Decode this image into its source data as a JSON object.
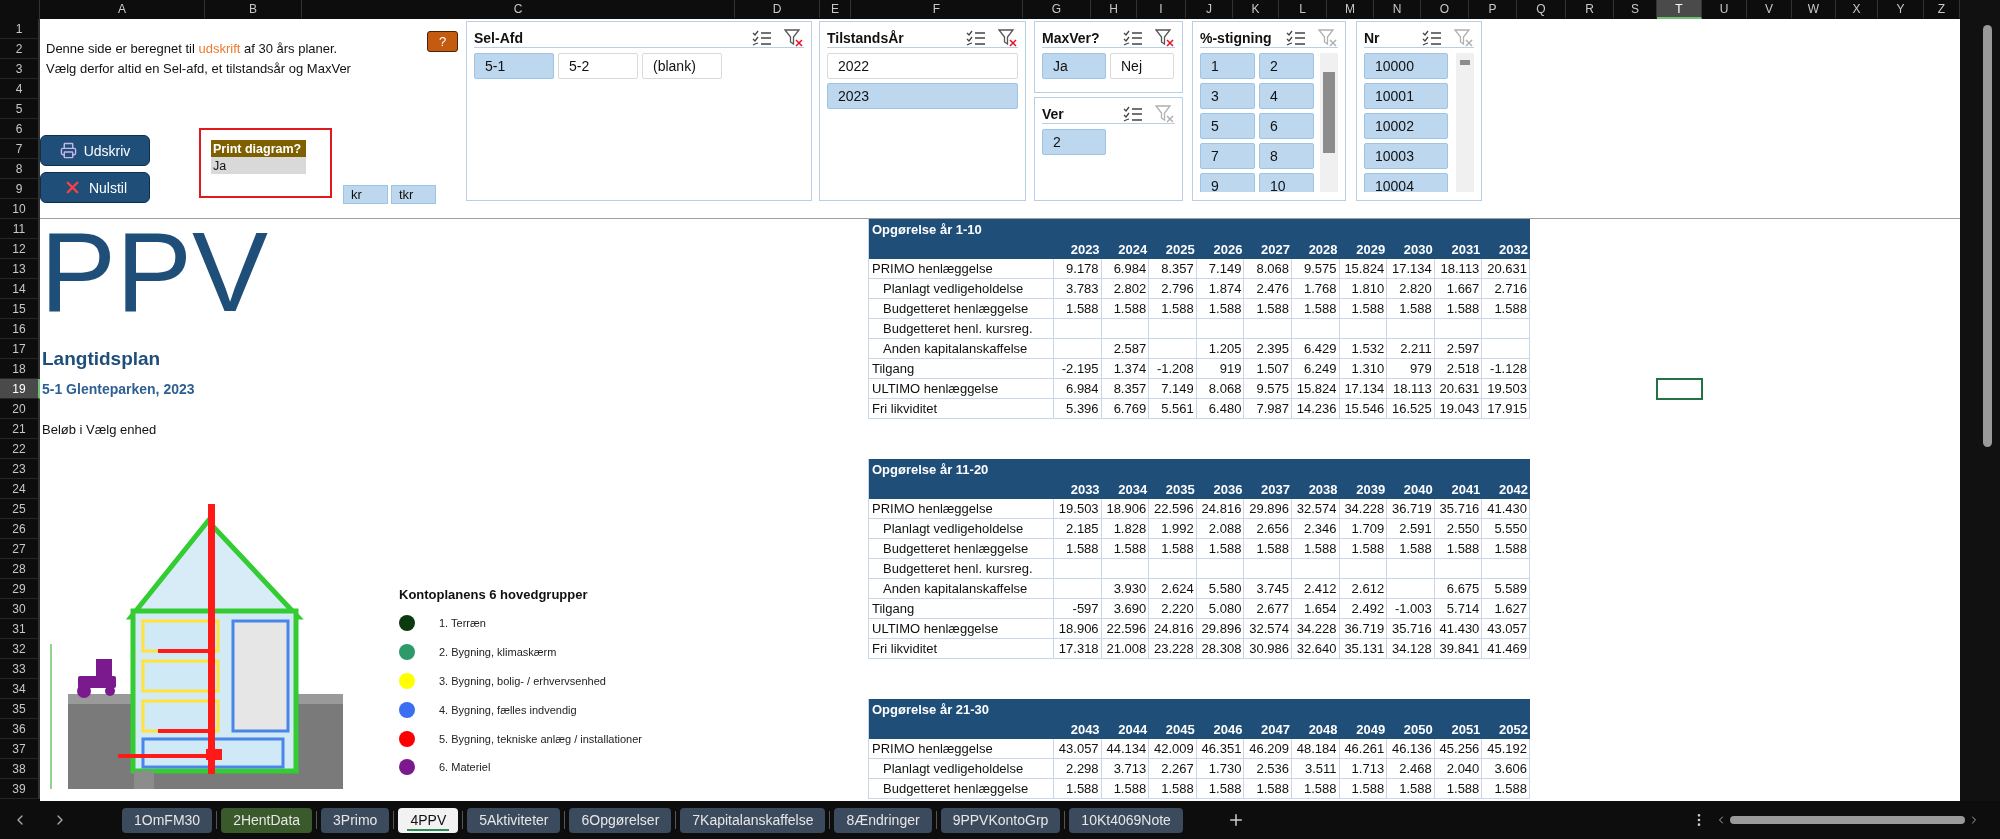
{
  "column_headers": [
    {
      "label": "A",
      "selected": false
    },
    {
      "label": "B",
      "selected": false
    },
    {
      "label": "C",
      "selected": false
    },
    {
      "label": "D",
      "selected": false
    },
    {
      "label": "E",
      "selected": false
    },
    {
      "label": "F",
      "selected": false
    },
    {
      "label": "G",
      "selected": false
    },
    {
      "label": "H",
      "selected": false
    },
    {
      "label": "I",
      "selected": false
    },
    {
      "label": "J",
      "selected": false
    },
    {
      "label": "K",
      "selected": false
    },
    {
      "label": "L",
      "selected": false
    },
    {
      "label": "M",
      "selected": false
    },
    {
      "label": "N",
      "selected": false
    },
    {
      "label": "O",
      "selected": false
    },
    {
      "label": "P",
      "selected": false
    },
    {
      "label": "Q",
      "selected": false
    },
    {
      "label": "R",
      "selected": false
    },
    {
      "label": "S",
      "selected": false
    },
    {
      "label": "T",
      "selected": true
    },
    {
      "label": "U",
      "selected": false
    },
    {
      "label": "V",
      "selected": false
    },
    {
      "label": "W",
      "selected": false
    },
    {
      "label": "X",
      "selected": false
    },
    {
      "label": "Y",
      "selected": false
    },
    {
      "label": "Z",
      "selected": false
    }
  ],
  "row_headers": [
    {
      "label": "1",
      "selected": false
    },
    {
      "label": "2",
      "selected": false
    },
    {
      "label": "3",
      "selected": false
    },
    {
      "label": "4",
      "selected": false
    },
    {
      "label": "5",
      "selected": false
    },
    {
      "label": "6",
      "selected": false
    },
    {
      "label": "7",
      "selected": false
    },
    {
      "label": "8",
      "selected": false
    },
    {
      "label": "9",
      "selected": false
    },
    {
      "label": "10",
      "selected": false
    },
    {
      "label": "11",
      "selected": false
    },
    {
      "label": "12",
      "selected": false
    },
    {
      "label": "13",
      "selected": false
    },
    {
      "label": "14",
      "selected": false
    },
    {
      "label": "15",
      "selected": false
    },
    {
      "label": "16",
      "selected": false
    },
    {
      "label": "17",
      "selected": false
    },
    {
      "label": "18",
      "selected": false
    },
    {
      "label": "19",
      "selected": true
    },
    {
      "label": "20",
      "selected": false
    },
    {
      "label": "21",
      "selected": false
    },
    {
      "label": "22",
      "selected": false
    },
    {
      "label": "23",
      "selected": false
    },
    {
      "label": "24",
      "selected": false
    },
    {
      "label": "25",
      "selected": false
    },
    {
      "label": "26",
      "selected": false
    },
    {
      "label": "27",
      "selected": false
    },
    {
      "label": "28",
      "selected": false
    },
    {
      "label": "29",
      "selected": false
    },
    {
      "label": "30",
      "selected": false
    },
    {
      "label": "31",
      "selected": false
    },
    {
      "label": "32",
      "selected": false
    },
    {
      "label": "33",
      "selected": false
    },
    {
      "label": "34",
      "selected": false
    },
    {
      "label": "35",
      "selected": false
    },
    {
      "label": "36",
      "selected": false
    },
    {
      "label": "37",
      "selected": false
    },
    {
      "label": "38",
      "selected": false
    },
    {
      "label": "39",
      "selected": false
    }
  ],
  "intro_lines": [
    [
      {
        "text": "Denne side er beregnet til ",
        "kind": "plain"
      },
      {
        "text": "udskrift",
        "kind": "highlight"
      },
      {
        "text": " af 30 års planer.",
        "kind": "plain"
      }
    ],
    [
      {
        "text": "Vælg derfor altid en Sel-afd, et tilstandsår og MaxVer",
        "kind": "plain"
      }
    ]
  ],
  "help_button": "?",
  "buttons": [
    {
      "label": "Udskriv",
      "kind": "print"
    },
    {
      "label": "Nulstil",
      "kind": "reset"
    }
  ],
  "print_diagram": {
    "label": "Print diagram?",
    "value": "Ja"
  },
  "unit_buttons": [
    "kr",
    "tkr"
  ],
  "slicers": [
    {
      "title": "Sel-Afd",
      "kind": "three-column",
      "filtered": true,
      "items": [
        {
          "label": "5-1",
          "selected": true
        },
        {
          "label": "5-2",
          "selected": false
        },
        {
          "label": "(blank)",
          "selected": false
        }
      ]
    },
    {
      "title": "TilstandsÅr",
      "kind": "one-column",
      "filtered": true,
      "items": [
        {
          "label": "2022",
          "selected": false
        },
        {
          "label": "2023",
          "selected": true
        }
      ]
    },
    {
      "title": "MaxVer?",
      "kind": "two-column",
      "filtered": true,
      "items": [
        {
          "label": "Ja",
          "selected": true
        },
        {
          "label": "Nej",
          "selected": false
        }
      ]
    },
    {
      "title": "Ver",
      "kind": "two-column",
      "filtered": false,
      "items": [
        {
          "label": "2",
          "selected": true
        }
      ]
    },
    {
      "title": "%-stigning",
      "kind": "two-column-scroll",
      "filtered": false,
      "items": [
        {
          "label": "1",
          "selected": true
        },
        {
          "label": "2",
          "selected": true
        },
        {
          "label": "3",
          "selected": true
        },
        {
          "label": "4",
          "selected": true
        },
        {
          "label": "5",
          "selected": true
        },
        {
          "label": "6",
          "selected": true
        },
        {
          "label": "7",
          "selected": true
        },
        {
          "label": "8",
          "selected": true
        },
        {
          "label": "9",
          "selected": true
        },
        {
          "label": "10",
          "selected": true
        }
      ]
    },
    {
      "title": "Nr",
      "kind": "one-column-scroll",
      "filtered": false,
      "items": [
        {
          "label": "10000",
          "selected": true
        },
        {
          "label": "10001",
          "selected": true
        },
        {
          "label": "10002",
          "selected": true
        },
        {
          "label": "10003",
          "selected": true
        },
        {
          "label": "10004",
          "selected": true
        }
      ]
    }
  ],
  "title": "PPV",
  "subtitle": "Langtidsplan",
  "plan_name": "5-1 Glenteparken, 2023",
  "amount_note": "Beløb i Vælg enhed",
  "legend": {
    "title": "Kontoplanens 6 hovedgrupper",
    "items": [
      {
        "label": "1. Terræn",
        "color": "#0b3a10"
      },
      {
        "label": "2. Bygning, klimaskærm",
        "color": "#2e9a6a"
      },
      {
        "label": "3. Bygning, bolig- / erhvervsenhed",
        "color": "#ffff00"
      },
      {
        "label": "4. Bygning, fælles indvendig",
        "color": "#3b6ff2"
      },
      {
        "label": "5. Bygning, tekniske anlæg / installationer",
        "color": "#ff0000"
      },
      {
        "label": "6. Materiel",
        "color": "#7b1a8e"
      }
    ]
  },
  "tables": [
    {
      "title": "Opgørelse år 1-10",
      "years": [
        "2023",
        "2024",
        "2025",
        "2026",
        "2027",
        "2028",
        "2029",
        "2030",
        "2031",
        "2032"
      ],
      "rows": [
        {
          "label": "PRIMO henlæggelse",
          "indent": false,
          "cells": [
            {
              "kind": "number",
              "value": "9.178"
            },
            {
              "kind": "number",
              "value": "6.984"
            },
            {
              "kind": "number",
              "value": "8.357"
            },
            {
              "kind": "number",
              "value": "7.149"
            },
            {
              "kind": "number",
              "value": "8.068"
            },
            {
              "kind": "number",
              "value": "9.575"
            },
            {
              "kind": "number",
              "value": "15.824"
            },
            {
              "kind": "number",
              "value": "17.134"
            },
            {
              "kind": "number",
              "value": "18.113"
            },
            {
              "kind": "number",
              "value": "20.631"
            }
          ]
        },
        {
          "label": "Planlagt vedligeholdelse",
          "indent": true,
          "cells": [
            {
              "kind": "number",
              "value": "3.783"
            },
            {
              "kind": "number",
              "value": "2.802"
            },
            {
              "kind": "number",
              "value": "2.796"
            },
            {
              "kind": "number",
              "value": "1.874"
            },
            {
              "kind": "number",
              "value": "2.476"
            },
            {
              "kind": "number",
              "value": "1.768"
            },
            {
              "kind": "number",
              "value": "1.810"
            },
            {
              "kind": "number",
              "value": "2.820"
            },
            {
              "kind": "number",
              "value": "1.667"
            },
            {
              "kind": "number",
              "value": "2.716"
            }
          ]
        },
        {
          "label": "Budgetteret henlæggelse",
          "indent": true,
          "cells": [
            {
              "kind": "number",
              "value": "1.588"
            },
            {
              "kind": "number",
              "value": "1.588"
            },
            {
              "kind": "number",
              "value": "1.588"
            },
            {
              "kind": "number",
              "value": "1.588"
            },
            {
              "kind": "number",
              "value": "1.588"
            },
            {
              "kind": "number",
              "value": "1.588"
            },
            {
              "kind": "number",
              "value": "1.588"
            },
            {
              "kind": "number",
              "value": "1.588"
            },
            {
              "kind": "number",
              "value": "1.588"
            },
            {
              "kind": "number",
              "value": "1.588"
            }
          ]
        },
        {
          "label": "Budgetteret henl. kursreg.",
          "indent": true,
          "cells": [
            {
              "kind": "blank"
            },
            {
              "kind": "blank"
            },
            {
              "kind": "blank"
            },
            {
              "kind": "blank"
            },
            {
              "kind": "blank"
            },
            {
              "kind": "blank"
            },
            {
              "kind": "blank"
            },
            {
              "kind": "blank"
            },
            {
              "kind": "blank"
            },
            {
              "kind": "blank"
            }
          ]
        },
        {
          "label": "Anden kapitalanskaffelse",
          "indent": true,
          "cells": [
            {
              "kind": "blank"
            },
            {
              "kind": "number",
              "value": "2.587"
            },
            {
              "kind": "blank"
            },
            {
              "kind": "number",
              "value": "1.205"
            },
            {
              "kind": "number",
              "value": "2.395"
            },
            {
              "kind": "number",
              "value": "6.429"
            },
            {
              "kind": "number",
              "value": "1.532"
            },
            {
              "kind": "number",
              "value": "2.211"
            },
            {
              "kind": "number",
              "value": "2.597"
            },
            {
              "kind": "blank"
            }
          ]
        },
        {
          "label": "Tilgang",
          "indent": false,
          "cells": [
            {
              "kind": "number",
              "value": "-2.195"
            },
            {
              "kind": "number",
              "value": "1.374"
            },
            {
              "kind": "number",
              "value": "-1.208"
            },
            {
              "kind": "number",
              "value": "919"
            },
            {
              "kind": "number",
              "value": "1.507"
            },
            {
              "kind": "number",
              "value": "6.249"
            },
            {
              "kind": "number",
              "value": "1.310"
            },
            {
              "kind": "number",
              "value": "979"
            },
            {
              "kind": "number",
              "value": "2.518"
            },
            {
              "kind": "number",
              "value": "-1.128"
            }
          ]
        },
        {
          "label": "ULTIMO henlæggelse",
          "indent": false,
          "cells": [
            {
              "kind": "number",
              "value": "6.984"
            },
            {
              "kind": "number",
              "value": "8.357"
            },
            {
              "kind": "number",
              "value": "7.149"
            },
            {
              "kind": "number",
              "value": "8.068"
            },
            {
              "kind": "number",
              "value": "9.575"
            },
            {
              "kind": "number",
              "value": "15.824"
            },
            {
              "kind": "number",
              "value": "17.134"
            },
            {
              "kind": "number",
              "value": "18.113"
            },
            {
              "kind": "number",
              "value": "20.631"
            },
            {
              "kind": "number",
              "value": "19.503"
            }
          ]
        },
        {
          "label": "Fri likviditet",
          "indent": false,
          "cells": [
            {
              "kind": "number",
              "value": "5.396"
            },
            {
              "kind": "number",
              "value": "6.769"
            },
            {
              "kind": "number",
              "value": "5.561"
            },
            {
              "kind": "number",
              "value": "6.480"
            },
            {
              "kind": "number",
              "value": "7.987"
            },
            {
              "kind": "number",
              "value": "14.236"
            },
            {
              "kind": "number",
              "value": "15.546"
            },
            {
              "kind": "number",
              "value": "16.525"
            },
            {
              "kind": "number",
              "value": "19.043"
            },
            {
              "kind": "number",
              "value": "17.915"
            }
          ]
        }
      ]
    },
    {
      "title": "Opgørelse år 11-20",
      "years": [
        "2033",
        "2034",
        "2035",
        "2036",
        "2037",
        "2038",
        "2039",
        "2040",
        "2041",
        "2042"
      ],
      "rows": [
        {
          "label": "PRIMO henlæggelse",
          "indent": false,
          "cells": [
            {
              "kind": "number",
              "value": "19.503"
            },
            {
              "kind": "number",
              "value": "18.906"
            },
            {
              "kind": "number",
              "value": "22.596"
            },
            {
              "kind": "number",
              "value": "24.816"
            },
            {
              "kind": "number",
              "value": "29.896"
            },
            {
              "kind": "number",
              "value": "32.574"
            },
            {
              "kind": "number",
              "value": "34.228"
            },
            {
              "kind": "number",
              "value": "36.719"
            },
            {
              "kind": "number",
              "value": "35.716"
            },
            {
              "kind": "number",
              "value": "41.430"
            }
          ]
        },
        {
          "label": "Planlagt vedligeholdelse",
          "indent": true,
          "cells": [
            {
              "kind": "number",
              "value": "2.185"
            },
            {
              "kind": "number",
              "value": "1.828"
            },
            {
              "kind": "number",
              "value": "1.992"
            },
            {
              "kind": "number",
              "value": "2.088"
            },
            {
              "kind": "number",
              "value": "2.656"
            },
            {
              "kind": "number",
              "value": "2.346"
            },
            {
              "kind": "number",
              "value": "1.709"
            },
            {
              "kind": "number",
              "value": "2.591"
            },
            {
              "kind": "number",
              "value": "2.550"
            },
            {
              "kind": "number",
              "value": "5.550"
            }
          ]
        },
        {
          "label": "Budgetteret henlæggelse",
          "indent": true,
          "cells": [
            {
              "kind": "number",
              "value": "1.588"
            },
            {
              "kind": "number",
              "value": "1.588"
            },
            {
              "kind": "number",
              "value": "1.588"
            },
            {
              "kind": "number",
              "value": "1.588"
            },
            {
              "kind": "number",
              "value": "1.588"
            },
            {
              "kind": "number",
              "value": "1.588"
            },
            {
              "kind": "number",
              "value": "1.588"
            },
            {
              "kind": "number",
              "value": "1.588"
            },
            {
              "kind": "number",
              "value": "1.588"
            },
            {
              "kind": "number",
              "value": "1.588"
            }
          ]
        },
        {
          "label": "Budgetteret henl. kursreg.",
          "indent": true,
          "cells": [
            {
              "kind": "blank"
            },
            {
              "kind": "blank"
            },
            {
              "kind": "blank"
            },
            {
              "kind": "blank"
            },
            {
              "kind": "blank"
            },
            {
              "kind": "blank"
            },
            {
              "kind": "blank"
            },
            {
              "kind": "blank"
            },
            {
              "kind": "blank"
            },
            {
              "kind": "blank"
            }
          ]
        },
        {
          "label": "Anden kapitalanskaffelse",
          "indent": true,
          "cells": [
            {
              "kind": "blank"
            },
            {
              "kind": "number",
              "value": "3.930"
            },
            {
              "kind": "number",
              "value": "2.624"
            },
            {
              "kind": "number",
              "value": "5.580"
            },
            {
              "kind": "number",
              "value": "3.745"
            },
            {
              "kind": "number",
              "value": "2.412"
            },
            {
              "kind": "number",
              "value": "2.612"
            },
            {
              "kind": "blank"
            },
            {
              "kind": "number",
              "value": "6.675"
            },
            {
              "kind": "number",
              "value": "5.589"
            }
          ]
        },
        {
          "label": "Tilgang",
          "indent": false,
          "cells": [
            {
              "kind": "number",
              "value": "-597"
            },
            {
              "kind": "number",
              "value": "3.690"
            },
            {
              "kind": "number",
              "value": "2.220"
            },
            {
              "kind": "number",
              "value": "5.080"
            },
            {
              "kind": "number",
              "value": "2.677"
            },
            {
              "kind": "number",
              "value": "1.654"
            },
            {
              "kind": "number",
              "value": "2.492"
            },
            {
              "kind": "number",
              "value": "-1.003"
            },
            {
              "kind": "number",
              "value": "5.714"
            },
            {
              "kind": "number",
              "value": "1.627"
            }
          ]
        },
        {
          "label": "ULTIMO henlæggelse",
          "indent": false,
          "cells": [
            {
              "kind": "number",
              "value": "18.906"
            },
            {
              "kind": "number",
              "value": "22.596"
            },
            {
              "kind": "number",
              "value": "24.816"
            },
            {
              "kind": "number",
              "value": "29.896"
            },
            {
              "kind": "number",
              "value": "32.574"
            },
            {
              "kind": "number",
              "value": "34.228"
            },
            {
              "kind": "number",
              "value": "36.719"
            },
            {
              "kind": "number",
              "value": "35.716"
            },
            {
              "kind": "number",
              "value": "41.430"
            },
            {
              "kind": "number",
              "value": "43.057"
            }
          ]
        },
        {
          "label": "Fri likviditet",
          "indent": false,
          "cells": [
            {
              "kind": "number",
              "value": "17.318"
            },
            {
              "kind": "number",
              "value": "21.008"
            },
            {
              "kind": "number",
              "value": "23.228"
            },
            {
              "kind": "number",
              "value": "28.308"
            },
            {
              "kind": "number",
              "value": "30.986"
            },
            {
              "kind": "number",
              "value": "32.640"
            },
            {
              "kind": "number",
              "value": "35.131"
            },
            {
              "kind": "number",
              "value": "34.128"
            },
            {
              "kind": "number",
              "value": "39.841"
            },
            {
              "kind": "number",
              "value": "41.469"
            }
          ]
        }
      ]
    },
    {
      "title": "Opgørelse år 21-30",
      "years": [
        "2043",
        "2044",
        "2045",
        "2046",
        "2047",
        "2048",
        "2049",
        "2050",
        "2051",
        "2052"
      ],
      "rows": [
        {
          "label": "PRIMO henlæggelse",
          "indent": false,
          "cells": [
            {
              "kind": "number",
              "value": "43.057"
            },
            {
              "kind": "number",
              "value": "44.134"
            },
            {
              "kind": "number",
              "value": "42.009"
            },
            {
              "kind": "number",
              "value": "46.351"
            },
            {
              "kind": "number",
              "value": "46.209"
            },
            {
              "kind": "number",
              "value": "48.184"
            },
            {
              "kind": "number",
              "value": "46.261"
            },
            {
              "kind": "number",
              "value": "46.136"
            },
            {
              "kind": "number",
              "value": "45.256"
            },
            {
              "kind": "number",
              "value": "45.192"
            }
          ]
        },
        {
          "label": "Planlagt vedligeholdelse",
          "indent": true,
          "cells": [
            {
              "kind": "number",
              "value": "2.298"
            },
            {
              "kind": "number",
              "value": "3.713"
            },
            {
              "kind": "number",
              "value": "2.267"
            },
            {
              "kind": "number",
              "value": "1.730"
            },
            {
              "kind": "number",
              "value": "2.536"
            },
            {
              "kind": "number",
              "value": "3.511"
            },
            {
              "kind": "number",
              "value": "1.713"
            },
            {
              "kind": "number",
              "value": "2.468"
            },
            {
              "kind": "number",
              "value": "2.040"
            },
            {
              "kind": "number",
              "value": "3.606"
            }
          ]
        },
        {
          "label": "Budgetteret henlæggelse",
          "indent": true,
          "cells": [
            {
              "kind": "number",
              "value": "1.588"
            },
            {
              "kind": "number",
              "value": "1.588"
            },
            {
              "kind": "number",
              "value": "1.588"
            },
            {
              "kind": "number",
              "value": "1.588"
            },
            {
              "kind": "number",
              "value": "1.588"
            },
            {
              "kind": "number",
              "value": "1.588"
            },
            {
              "kind": "number",
              "value": "1.588"
            },
            {
              "kind": "number",
              "value": "1.588"
            },
            {
              "kind": "number",
              "value": "1.588"
            },
            {
              "kind": "number",
              "value": "1.588"
            }
          ]
        }
      ]
    }
  ],
  "sheet_tabs": [
    {
      "label": "1OmFM30",
      "selected": false,
      "color": "#3c4a5e"
    },
    {
      "label": "2HentData",
      "selected": false,
      "color": "#3b5a2b"
    },
    {
      "label": "3Primo",
      "selected": false,
      "color": "#3c4a5e"
    },
    {
      "label": "4PPV",
      "selected": true,
      "color": "#2e8b57"
    },
    {
      "label": "5Aktiviteter",
      "selected": false,
      "color": "#3c4a5e"
    },
    {
      "label": "6Opgørelser",
      "selected": false,
      "color": "#3c4a5e"
    },
    {
      "label": "7Kapitalanskaffelse",
      "selected": false,
      "color": "#3c4a5e"
    },
    {
      "label": "8Ændringer",
      "selected": false,
      "color": "#3c4a5e"
    },
    {
      "label": "9PPVKontoGrp",
      "selected": false,
      "color": "#3c4a5e"
    },
    {
      "label": "10Kt4069Note",
      "selected": false,
      "color": "#3c4a5e"
    }
  ]
}
